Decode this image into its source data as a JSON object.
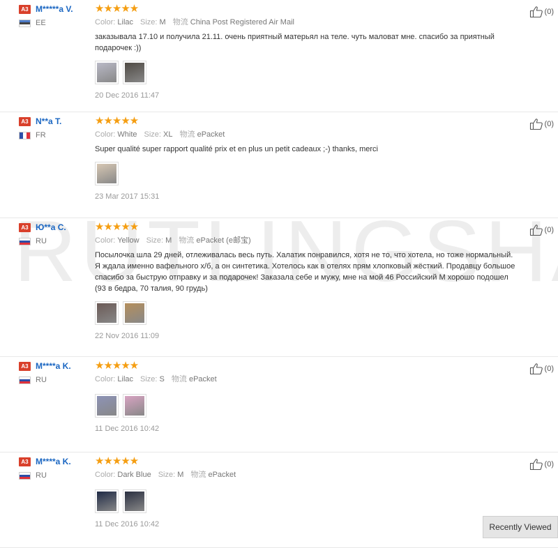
{
  "watermark": "RUTLINGSHA",
  "reviews": [
    {
      "level": "A3",
      "name": "M*****a V.",
      "country": "EE",
      "flag": "ee",
      "stars": "★★★★★",
      "attrs": [
        {
          "label": "Color:",
          "value": "Lilac"
        },
        {
          "label": "Size:",
          "value": "M"
        },
        {
          "label": "物流",
          "value": "China Post Registered Air Mail"
        }
      ],
      "text": "заказывала 17.10 и получила 21.11. очень приятный матерьял на теле. чуть маловат мне. спасибо за приятный подарочек :))",
      "date": "20 Dec 2016 11:47",
      "helpful": "(0)",
      "photos": [
        "#b9b9c6",
        "#4f4a44"
      ]
    },
    {
      "level": "A3",
      "name": "N**a T.",
      "country": "FR",
      "flag": "fr",
      "stars": "★★★★★",
      "attrs": [
        {
          "label": "Color:",
          "value": "White"
        },
        {
          "label": "Size:",
          "value": "XL"
        },
        {
          "label": "物流",
          "value": "ePacket"
        }
      ],
      "text": "Super qualité super rapport qualité prix et en plus un petit cadeaux ;-) thanks, merci",
      "date": "23 Mar 2017 15:31",
      "helpful": "(0)",
      "photos": [
        "#d7c7b3"
      ]
    },
    {
      "level": "A3",
      "name": "Ю**а С.",
      "country": "RU",
      "flag": "ru",
      "stars": "★★★★★",
      "attrs": [
        {
          "label": "Color:",
          "value": "Yellow"
        },
        {
          "label": "Size:",
          "value": "M"
        },
        {
          "label": "物流",
          "value": "ePacket (e邮宝)"
        }
      ],
      "text": "Посылочка шла 29 дней, отлеживалась весь путь. Халатик понравился, хотя не то, что хотела, но тоже нормальный. Я ждала именно вафельного х/б, а он синтетика. Хотелось как в отелях прям хлопковый жёсткий. Продавцу большое спасибо за быструю отправку и за подарочек! Заказала себе и мужу, мне на мой 46 Российский М хорошо подошел (93 в бедра, 70 талия, 90 грудь)",
      "date": "22 Nov 2016 11:09",
      "helpful": "(0)",
      "photos": [
        "#6b5a56",
        "#b58f5c"
      ]
    },
    {
      "level": "A3",
      "name": "M****a K.",
      "country": "RU",
      "flag": "ru",
      "stars": "★★★★★",
      "attrs": [
        {
          "label": "Color:",
          "value": "Lilac"
        },
        {
          "label": "Size:",
          "value": "S"
        },
        {
          "label": "物流",
          "value": "ePacket"
        }
      ],
      "text": "",
      "date": "11 Dec 2016 10:42",
      "helpful": "(0)",
      "photos": [
        "#8d93b6",
        "#d8a3c2"
      ]
    },
    {
      "level": "A3",
      "name": "M****a K.",
      "country": "RU",
      "flag": "ru",
      "stars": "★★★★★",
      "attrs": [
        {
          "label": "Color:",
          "value": "Dark Blue"
        },
        {
          "label": "Size:",
          "value": "M"
        },
        {
          "label": "物流",
          "value": "ePacket"
        }
      ],
      "text": "",
      "date": "11 Dec 2016 10:42",
      "helpful": "(0)",
      "photos": [
        "#1f2a45",
        "#2a2f40"
      ]
    }
  ],
  "recently_viewed": "Recently Viewed"
}
